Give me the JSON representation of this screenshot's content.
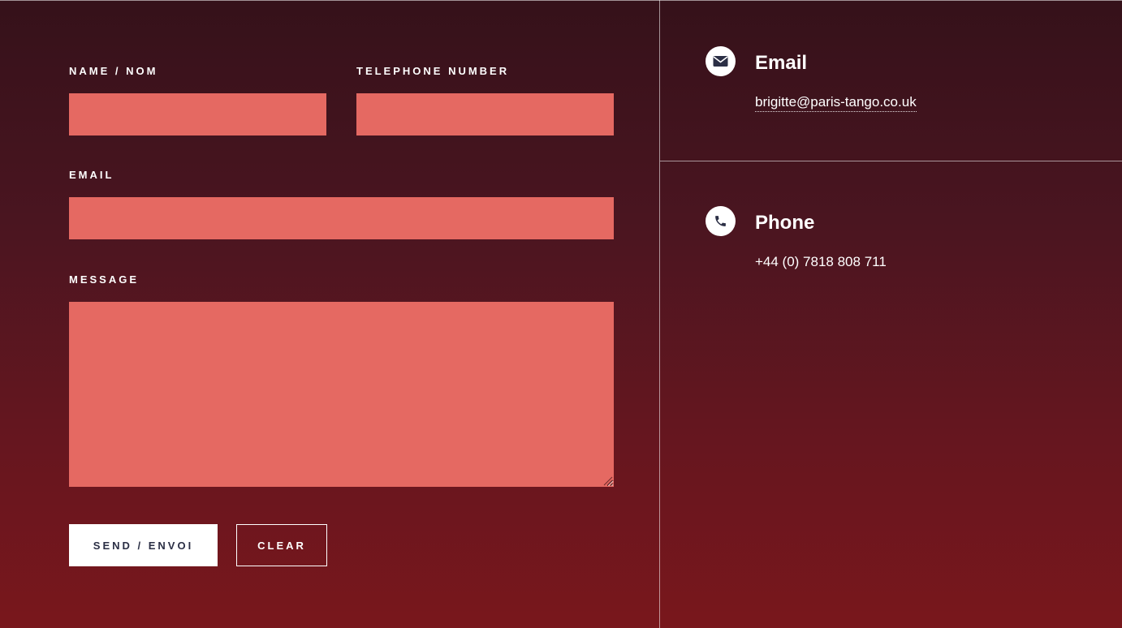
{
  "form": {
    "name_label": "NAME / NOM",
    "telephone_label": "TELEPHONE NUMBER",
    "email_label": "EMAIL",
    "message_label": "MESSAGE",
    "name_value": "",
    "telephone_value": "",
    "email_value": "",
    "message_value": "",
    "send_label": "SEND / ENVOI",
    "clear_label": "CLEAR"
  },
  "contact": {
    "email": {
      "icon": "envelope-icon",
      "title": "Email",
      "value": "brigitte@paris-tango.co.uk"
    },
    "phone": {
      "icon": "phone-icon",
      "title": "Phone",
      "value": "+44 (0) 7818 808 711"
    }
  },
  "colors": {
    "background_top": "#35111a",
    "background_bottom": "#79171c",
    "field": "#e56962",
    "button_text": "#2b2f45",
    "icon": "#2b2f45"
  }
}
